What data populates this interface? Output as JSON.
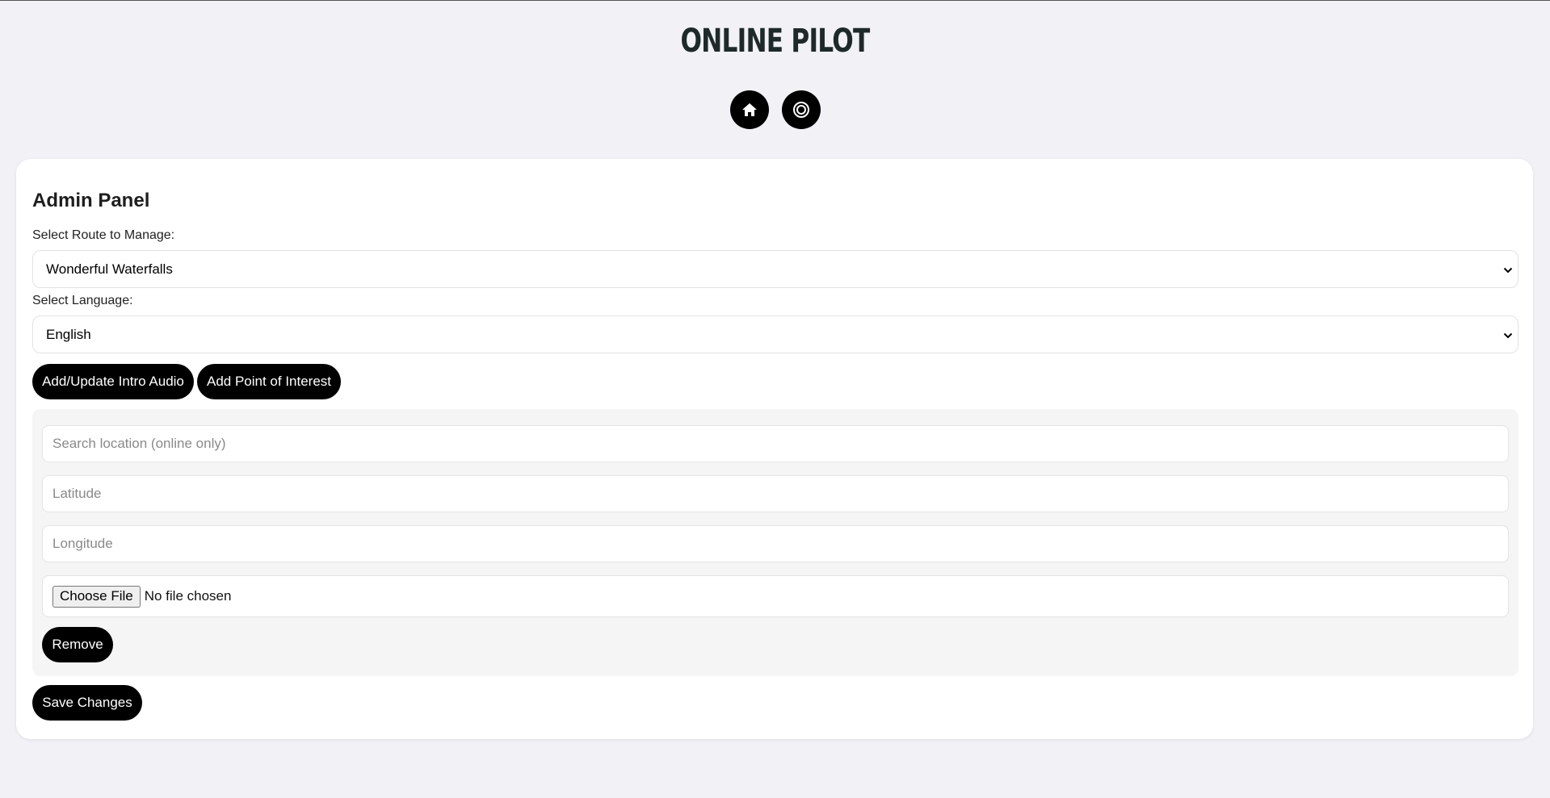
{
  "header": {
    "title": "ONLINE PILOT",
    "nav": [
      {
        "icon": "home-icon"
      },
      {
        "icon": "target-icon"
      }
    ]
  },
  "admin": {
    "title": "Admin Panel",
    "route_label": "Select Route to Manage:",
    "route_value": "Wonderful Waterfalls",
    "language_label": "Select Language:",
    "language_value": "English",
    "intro_audio_button": "Add/Update Intro Audio",
    "add_poi_button": "Add Point of Interest",
    "poi": {
      "search_placeholder": "Search location (online only)",
      "latitude_placeholder": "Latitude",
      "longitude_placeholder": "Longitude",
      "file_button": "Choose File",
      "file_status": "No file chosen",
      "remove_button": "Remove"
    },
    "save_button": "Save Changes"
  },
  "colors": {
    "background": "#f1f1f6",
    "panel": "#ffffff",
    "button": "#000000",
    "button_text": "#ffffff",
    "title": "#1e2a2a"
  }
}
